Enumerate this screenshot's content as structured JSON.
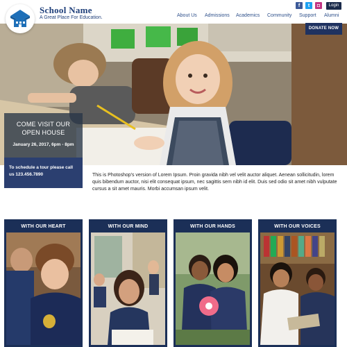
{
  "header": {
    "school_name": "School Name",
    "tagline": "A Great Place For Education.",
    "nav": [
      "About Us",
      "Admissions",
      "Academics",
      "Community",
      "Support",
      "Alumni"
    ],
    "login_label": "Login",
    "social": [
      {
        "icon": "facebook-icon",
        "glyph": "f",
        "color": "#3b5998"
      },
      {
        "icon": "twitter-icon",
        "glyph": "t",
        "color": "#1da1f2"
      },
      {
        "icon": "instagram-icon",
        "glyph": "◘",
        "color": "#c13584"
      }
    ]
  },
  "hero": {
    "donate_label": "DONATE NOW",
    "open_house": {
      "title_line1": "COME VISIT OUR",
      "title_line2": "OPEN HOUSE",
      "date": "January 26, 2017, 6pm - 8pm",
      "contact_line1": "To schedule a tour please call",
      "contact_line2": "us 123.456.7890"
    }
  },
  "intro": "This is Photoshop's version of Lorem Ipsum. Proin gravida nibh vel velit auctor aliquet. Aenean sollicitudin, lorem quis bibendum auctor, nisi elit consequat ipsum, nec sagittis sem nibh id elit. Duis sed odio sit amet nibh vulputate cursus a sit amet mauris. Morbi accumsan ipsum velit.",
  "cards": [
    {
      "title": "WITH OUR HEART"
    },
    {
      "title": "WITH OUR MIND"
    },
    {
      "title": "WITH OUR HANDS"
    },
    {
      "title": "WITH OUR VOICES"
    }
  ],
  "colors": {
    "navy": "#1b2f57",
    "brand": "#1f3f7a",
    "donate": "#1f3260"
  }
}
